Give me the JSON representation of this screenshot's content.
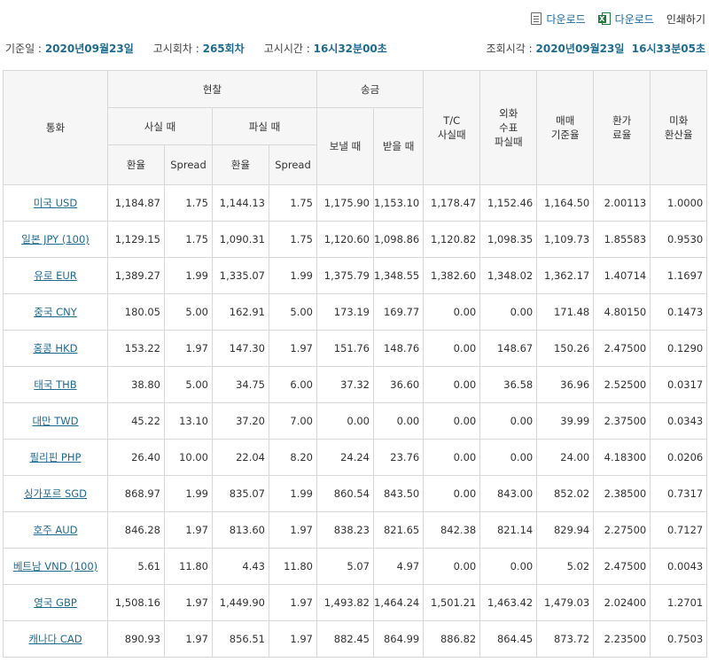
{
  "toolbar": {
    "download1": "다운로드",
    "download2": "다운로드",
    "print": "인쇄하기",
    "icons": [
      "document-icon",
      "excel-icon"
    ]
  },
  "info": {
    "date_label": "기준일 :",
    "date_value": "2020년09월23일",
    "round_label": "고시회차 :",
    "round_value": "265회차",
    "time_label": "고시시간 :",
    "time_value": "16시32분00초",
    "query_label": "조회시각 :",
    "query_value": "2020년09월23일  16시33분05초"
  },
  "headers": {
    "currency": "통화",
    "cash": "현찰",
    "remit": "송금",
    "cash_buy": "사실 때",
    "cash_sell": "파실 때",
    "rate": "환율",
    "spread": "Spread",
    "send": "보낼 때",
    "receive": "받을 때",
    "tc_buy": "T/C\n사실때",
    "check_sell": "외화\n수표\n파실때",
    "base_rate": "매매\n기준율",
    "exch_rate": "환가\n료율",
    "usd_rate": "미화\n환산율"
  },
  "rows": [
    {
      "currency": "미국 USD",
      "cash_buy_rate": "1,184.87",
      "cash_buy_spread": "1.75",
      "cash_sell_rate": "1,144.13",
      "cash_sell_spread": "1.75",
      "send": "1,175.90",
      "receive": "1,153.10",
      "tc_buy": "1,178.47",
      "check_sell": "1,152.46",
      "base": "1,164.50",
      "exch": "2.00113",
      "usd": "1.0000"
    },
    {
      "currency": "일본 JPY (100)",
      "cash_buy_rate": "1,129.15",
      "cash_buy_spread": "1.75",
      "cash_sell_rate": "1,090.31",
      "cash_sell_spread": "1.75",
      "send": "1,120.60",
      "receive": "1,098.86",
      "tc_buy": "1,120.82",
      "check_sell": "1,098.35",
      "base": "1,109.73",
      "exch": "1.85583",
      "usd": "0.9530"
    },
    {
      "currency": "유로 EUR",
      "cash_buy_rate": "1,389.27",
      "cash_buy_spread": "1.99",
      "cash_sell_rate": "1,335.07",
      "cash_sell_spread": "1.99",
      "send": "1,375.79",
      "receive": "1,348.55",
      "tc_buy": "1,382.60",
      "check_sell": "1,348.02",
      "base": "1,362.17",
      "exch": "1.40714",
      "usd": "1.1697"
    },
    {
      "currency": "중국 CNY",
      "cash_buy_rate": "180.05",
      "cash_buy_spread": "5.00",
      "cash_sell_rate": "162.91",
      "cash_sell_spread": "5.00",
      "send": "173.19",
      "receive": "169.77",
      "tc_buy": "0.00",
      "check_sell": "0.00",
      "base": "171.48",
      "exch": "4.80150",
      "usd": "0.1473"
    },
    {
      "currency": "홍콩 HKD",
      "cash_buy_rate": "153.22",
      "cash_buy_spread": "1.97",
      "cash_sell_rate": "147.30",
      "cash_sell_spread": "1.97",
      "send": "151.76",
      "receive": "148.76",
      "tc_buy": "0.00",
      "check_sell": "148.67",
      "base": "150.26",
      "exch": "2.47500",
      "usd": "0.1290"
    },
    {
      "currency": "태국 THB",
      "cash_buy_rate": "38.80",
      "cash_buy_spread": "5.00",
      "cash_sell_rate": "34.75",
      "cash_sell_spread": "6.00",
      "send": "37.32",
      "receive": "36.60",
      "tc_buy": "0.00",
      "check_sell": "36.58",
      "base": "36.96",
      "exch": "2.52500",
      "usd": "0.0317"
    },
    {
      "currency": "대만 TWD",
      "cash_buy_rate": "45.22",
      "cash_buy_spread": "13.10",
      "cash_sell_rate": "37.20",
      "cash_sell_spread": "7.00",
      "send": "0.00",
      "receive": "0.00",
      "tc_buy": "0.00",
      "check_sell": "0.00",
      "base": "39.99",
      "exch": "2.37500",
      "usd": "0.0343"
    },
    {
      "currency": "필리핀 PHP",
      "cash_buy_rate": "26.40",
      "cash_buy_spread": "10.00",
      "cash_sell_rate": "22.04",
      "cash_sell_spread": "8.20",
      "send": "24.24",
      "receive": "23.76",
      "tc_buy": "0.00",
      "check_sell": "0.00",
      "base": "24.00",
      "exch": "4.18300",
      "usd": "0.0206"
    },
    {
      "currency": "싱가포르 SGD",
      "cash_buy_rate": "868.97",
      "cash_buy_spread": "1.99",
      "cash_sell_rate": "835.07",
      "cash_sell_spread": "1.99",
      "send": "860.54",
      "receive": "843.50",
      "tc_buy": "0.00",
      "check_sell": "843.00",
      "base": "852.02",
      "exch": "2.38500",
      "usd": "0.7317"
    },
    {
      "currency": "호주 AUD",
      "cash_buy_rate": "846.28",
      "cash_buy_spread": "1.97",
      "cash_sell_rate": "813.60",
      "cash_sell_spread": "1.97",
      "send": "838.23",
      "receive": "821.65",
      "tc_buy": "842.38",
      "check_sell": "821.14",
      "base": "829.94",
      "exch": "2.27500",
      "usd": "0.7127"
    },
    {
      "currency": "베트남 VND (100)",
      "cash_buy_rate": "5.61",
      "cash_buy_spread": "11.80",
      "cash_sell_rate": "4.43",
      "cash_sell_spread": "11.80",
      "send": "5.07",
      "receive": "4.97",
      "tc_buy": "0.00",
      "check_sell": "0.00",
      "base": "5.02",
      "exch": "2.47500",
      "usd": "0.0043"
    },
    {
      "currency": "영국 GBP",
      "cash_buy_rate": "1,508.16",
      "cash_buy_spread": "1.97",
      "cash_sell_rate": "1,449.90",
      "cash_sell_spread": "1.97",
      "send": "1,493.82",
      "receive": "1,464.24",
      "tc_buy": "1,501.21",
      "check_sell": "1,463.42",
      "base": "1,479.03",
      "exch": "2.02400",
      "usd": "1.2701"
    },
    {
      "currency": "캐나다 CAD",
      "cash_buy_rate": "890.93",
      "cash_buy_spread": "1.97",
      "cash_sell_rate": "856.51",
      "cash_sell_spread": "1.97",
      "send": "882.45",
      "receive": "864.99",
      "tc_buy": "886.82",
      "check_sell": "864.45",
      "base": "873.72",
      "exch": "2.23500",
      "usd": "0.7503"
    }
  ]
}
